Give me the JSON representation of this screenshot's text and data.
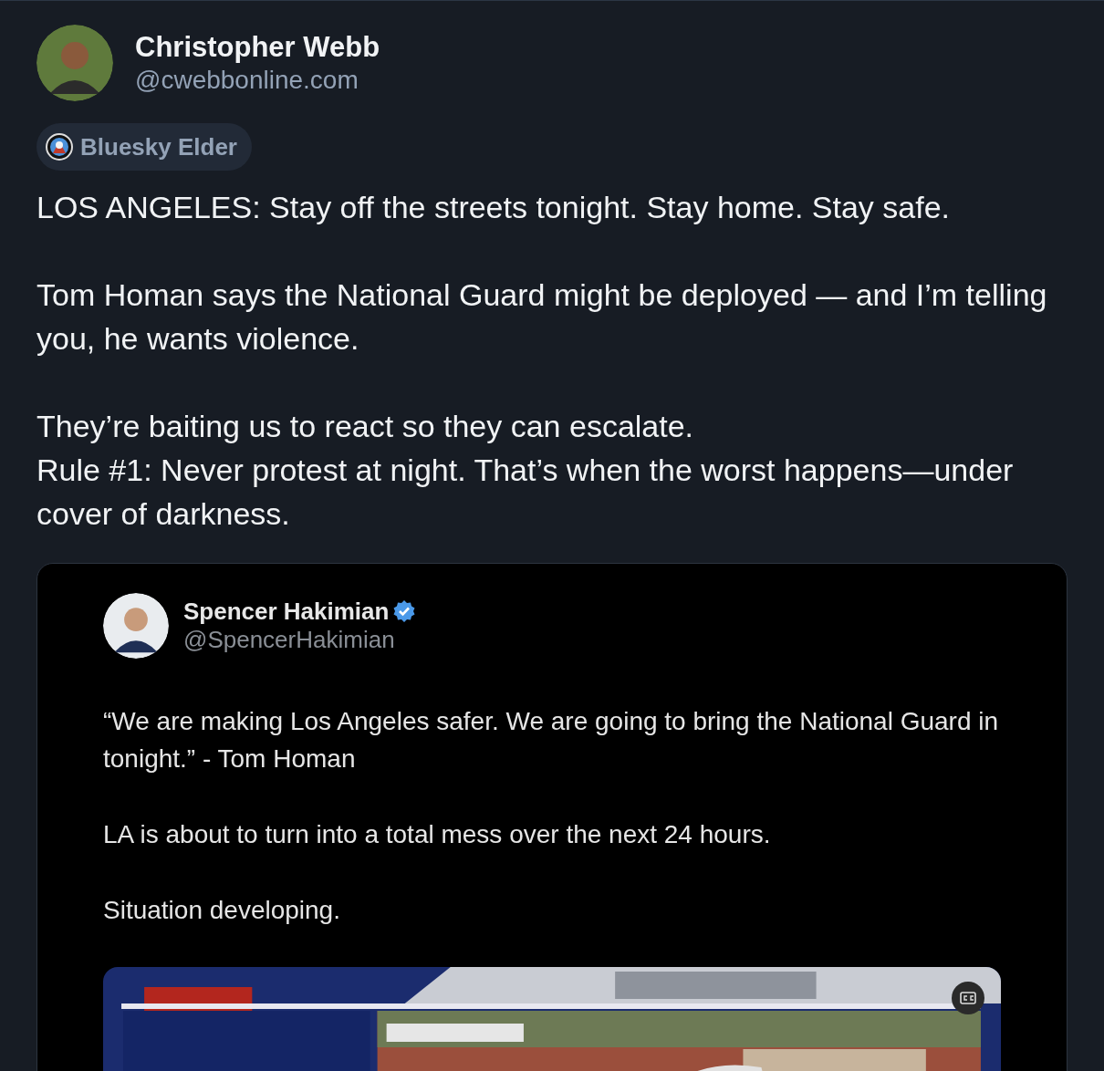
{
  "author": {
    "name": "Christopher Webb",
    "handle": "@cwebbonline.com"
  },
  "badge": {
    "label": "Bluesky Elder"
  },
  "post": {
    "paragraphs": [
      "LOS ANGELES: Stay off the streets tonight. Stay home. Stay safe.",
      "Tom Homan says the National Guard might be deployed — and I’m telling you, he wants violence.",
      "They’re baiting us to react so they can escalate.\nRule #1: Never protest at night. That’s when the worst happens—under cover of darkness."
    ]
  },
  "embed": {
    "author": {
      "name": "Spencer Hakimian",
      "handle": "@SpencerHakimian",
      "verified": true
    },
    "paragraphs": [
      "“We are making Los Angeles safer. We are going to bring the National Guard in tonight.” - Tom Homan",
      "LA is about to turn into a total mess over the next 24 hours.",
      "Situation developing."
    ]
  }
}
